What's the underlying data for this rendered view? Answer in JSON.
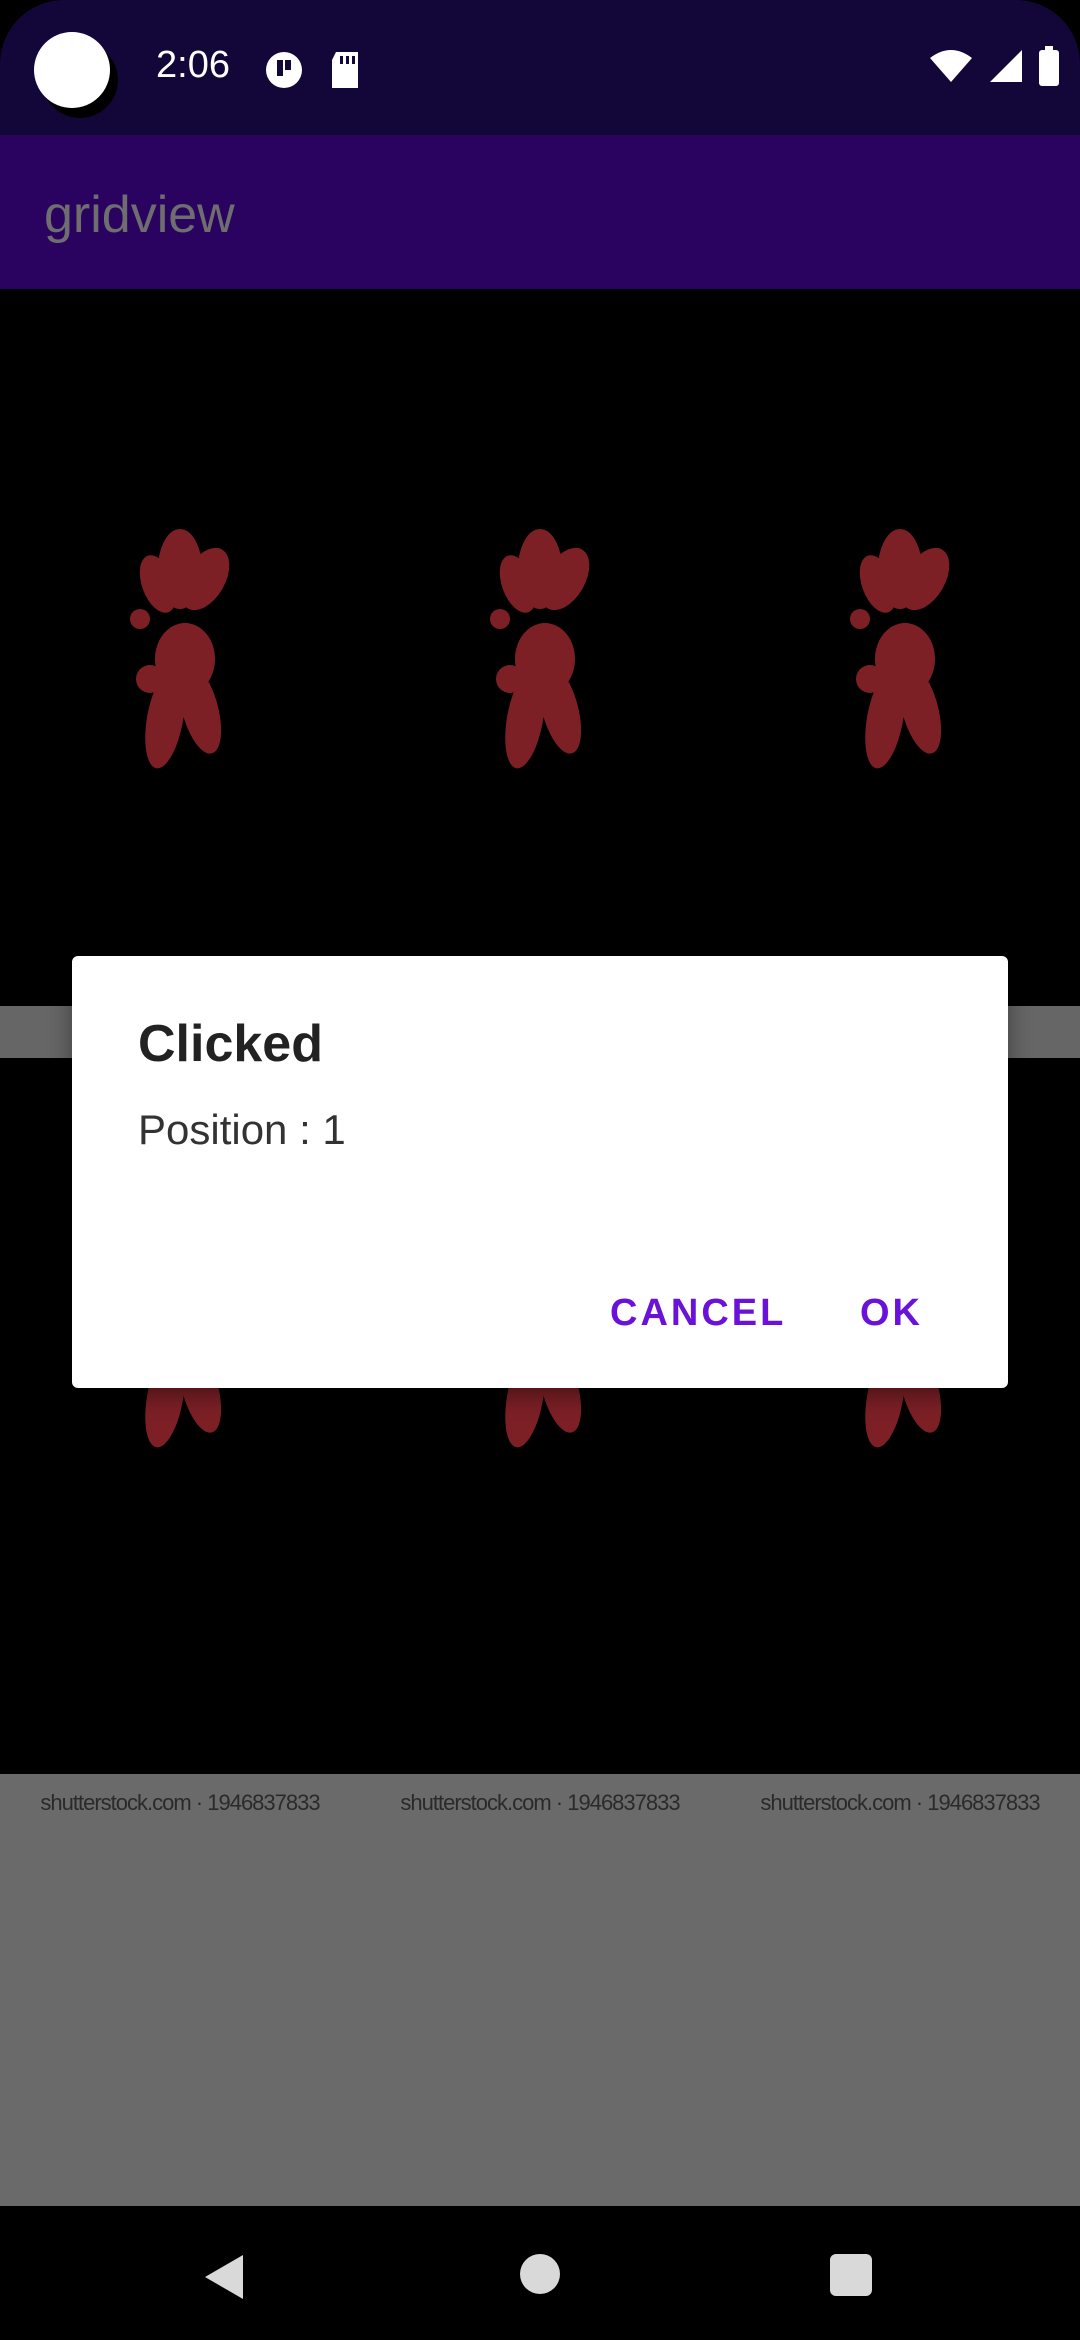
{
  "status_bar": {
    "time": "2:06"
  },
  "app_bar": {
    "title": "gridview"
  },
  "grid": {
    "watermarks": [
      "shutterstock.com · 1946837833",
      "shutterstock.com · 1946837833",
      "shutterstock.com · 1946837833"
    ]
  },
  "dialog": {
    "title": "Clicked",
    "message": "Position : 1",
    "cancel_label": "CANCEL",
    "ok_label": "OK"
  },
  "colors": {
    "status_bar": "#130639",
    "app_bar": "#2a0260",
    "accent": "#6a12d8",
    "flower": "#8a2a30"
  }
}
